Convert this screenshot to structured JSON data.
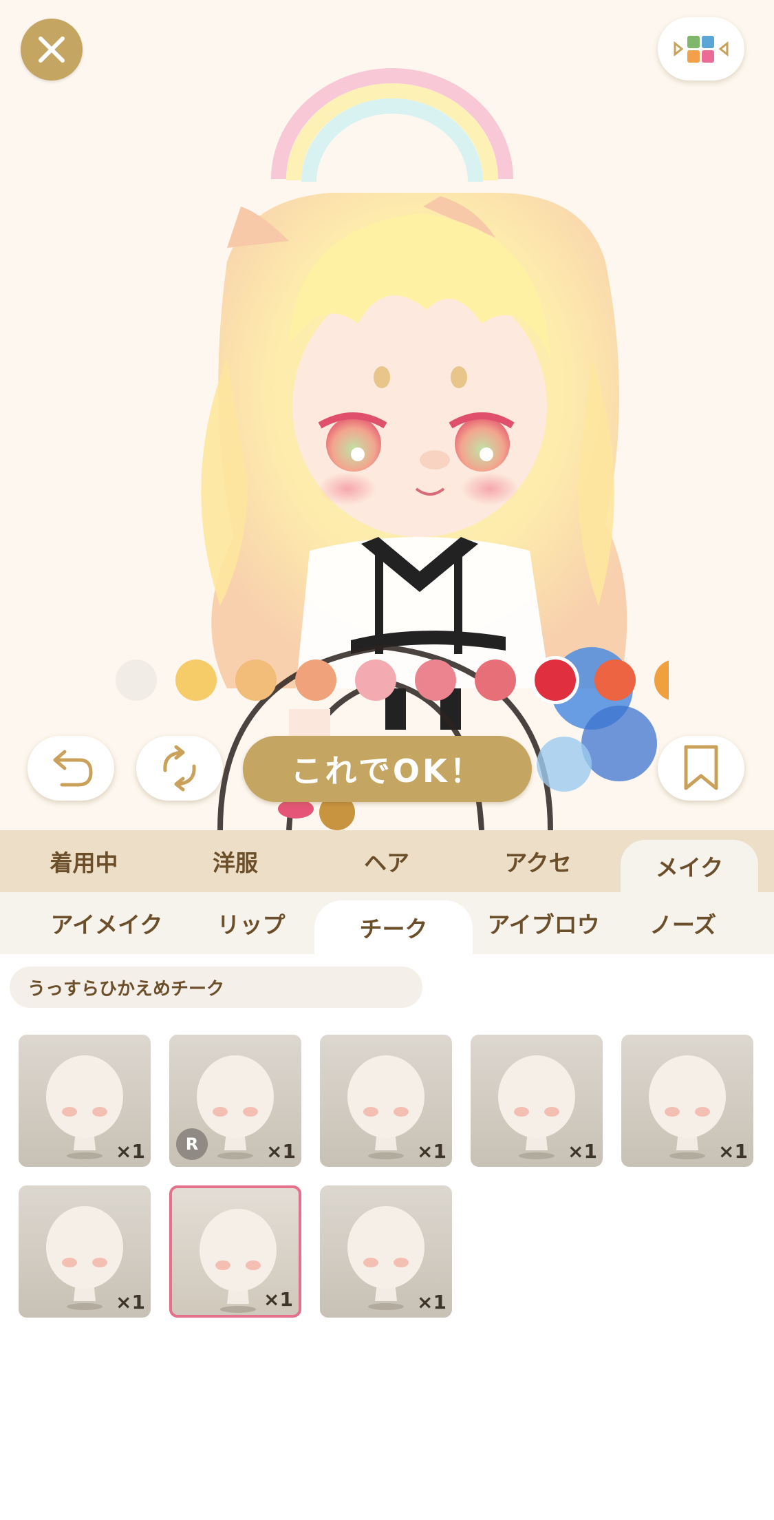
{
  "header": {
    "close_icon": "close-icon",
    "layout_icon": "layout-switch-icon"
  },
  "color_palette": {
    "colors": [
      "#f1ede6",
      "#f6cc68",
      "#f2bc79",
      "#f0a27a",
      "#f3aab0",
      "#ec848f",
      "#e76f78",
      "#e0303f",
      "#ec6442",
      "#f0a03c"
    ],
    "selected_index": 7
  },
  "actions": {
    "undo_icon": "undo-icon",
    "reset_icon": "refresh-icon",
    "ok_label": "これでOK！",
    "bookmark_icon": "bookmark-icon"
  },
  "categories": [
    {
      "label": "着用中"
    },
    {
      "label": "洋服"
    },
    {
      "label": "ヘア"
    },
    {
      "label": "アクセ"
    },
    {
      "label": "メイク"
    }
  ],
  "active_category": 4,
  "subcategories": [
    {
      "label": "アイメイク"
    },
    {
      "label": "リップ"
    },
    {
      "label": "チーク"
    },
    {
      "label": "アイブロウ"
    },
    {
      "label": "ノーズ"
    }
  ],
  "active_subcategory": 2,
  "selected_item_name": "うっすらひかえめチーク",
  "items": [
    {
      "qty": "×1",
      "badge": ""
    },
    {
      "qty": "×1",
      "badge": "R"
    },
    {
      "qty": "×1",
      "badge": ""
    },
    {
      "qty": "×1",
      "badge": ""
    },
    {
      "qty": "×1",
      "badge": ""
    },
    {
      "qty": "×1",
      "badge": ""
    },
    {
      "qty": "×1",
      "badge": "",
      "selected": true
    },
    {
      "qty": "×1",
      "badge": ""
    }
  ]
}
